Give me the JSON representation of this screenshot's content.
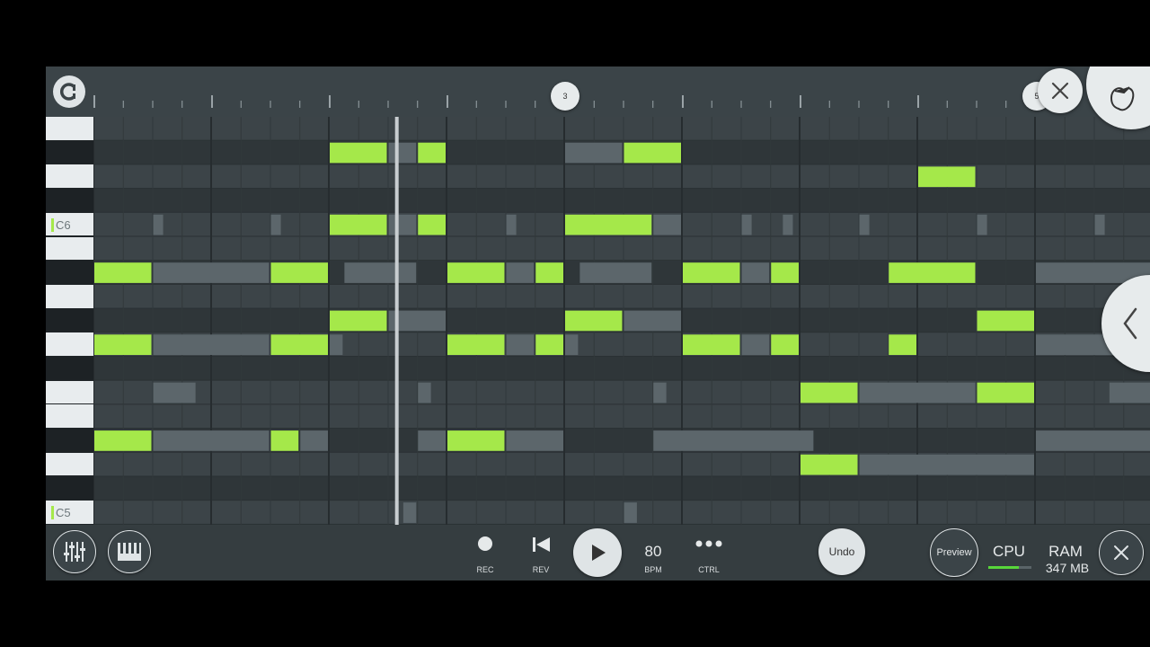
{
  "ruler": {
    "markers": [
      "3",
      "5"
    ]
  },
  "keyboard": {
    "labels": [
      "C6",
      "C5"
    ]
  },
  "toolbar": {
    "rec_label": "REC",
    "rev_label": "REV",
    "tempo_value": "80",
    "tempo_label": "BPM",
    "ctrl_label": "CTRL",
    "undo_label": "Undo",
    "preview_label": "Preview",
    "cpu_label": "CPU",
    "ram_label": "RAM",
    "ram_value": "347 MB"
  },
  "icons": [
    "fl-logo-icon",
    "close-icon",
    "fruit-logo-icon",
    "collapse-chevron-icon",
    "mixer-icon",
    "piano-icon",
    "record-icon",
    "rewind-icon",
    "play-icon",
    "more-icon",
    "close-icon"
  ],
  "colors": {
    "note": "#a5e84a",
    "ghost_note": "#5c666b",
    "grid_bg": "#394045",
    "playhead": "#c8cdd0"
  },
  "notes": [
    {
      "row": 1,
      "start": 8,
      "len": 2
    },
    {
      "row": 1,
      "start": 11,
      "len": 1
    },
    {
      "row": 1,
      "start": 18,
      "len": 2
    },
    {
      "row": 2,
      "start": 28,
      "len": 2
    },
    {
      "row": 4,
      "start": 8,
      "len": 2
    },
    {
      "row": 4,
      "start": 11,
      "len": 1
    },
    {
      "row": 4,
      "start": 16,
      "len": 3
    },
    {
      "row": 6,
      "start": 0,
      "len": 2
    },
    {
      "row": 6,
      "start": 6,
      "len": 2
    },
    {
      "row": 6,
      "start": 12,
      "len": 2
    },
    {
      "row": 6,
      "start": 15,
      "len": 1
    },
    {
      "row": 6,
      "start": 20,
      "len": 2
    },
    {
      "row": 6,
      "start": 23,
      "len": 1
    },
    {
      "row": 6,
      "start": 27,
      "len": 3
    },
    {
      "row": 8,
      "start": 8,
      "len": 2
    },
    {
      "row": 8,
      "start": 16,
      "len": 2
    },
    {
      "row": 8,
      "start": 30,
      "len": 2
    },
    {
      "row": 9,
      "start": 0,
      "len": 2
    },
    {
      "row": 9,
      "start": 6,
      "len": 2
    },
    {
      "row": 9,
      "start": 12,
      "len": 2
    },
    {
      "row": 9,
      "start": 15,
      "len": 1
    },
    {
      "row": 9,
      "start": 20,
      "len": 2
    },
    {
      "row": 9,
      "start": 23,
      "len": 1
    },
    {
      "row": 9,
      "start": 27,
      "len": 1
    },
    {
      "row": 11,
      "start": 24,
      "len": 2
    },
    {
      "row": 11,
      "start": 30,
      "len": 2
    },
    {
      "row": 13,
      "start": 0,
      "len": 2
    },
    {
      "row": 13,
      "start": 6,
      "len": 1
    },
    {
      "row": 13,
      "start": 12,
      "len": 2
    },
    {
      "row": 14,
      "start": 24,
      "len": 2
    }
  ],
  "ghost_notes": [
    {
      "row": 1,
      "start": 10,
      "len": 1
    },
    {
      "row": 1,
      "start": 16,
      "len": 2
    },
    {
      "row": 4,
      "start": 2,
      "len": 0.4
    },
    {
      "row": 4,
      "start": 6,
      "len": 0.4
    },
    {
      "row": 4,
      "start": 10,
      "len": 1
    },
    {
      "row": 4,
      "start": 14,
      "len": 0.4
    },
    {
      "row": 4,
      "start": 19,
      "len": 1
    },
    {
      "row": 4,
      "start": 22,
      "len": 0.4
    },
    {
      "row": 4,
      "start": 23.4,
      "len": 0.4
    },
    {
      "row": 4,
      "start": 26,
      "len": 0.4
    },
    {
      "row": 4,
      "start": 30,
      "len": 0.4
    },
    {
      "row": 4,
      "start": 34,
      "len": 0.4
    },
    {
      "row": 6,
      "start": 2,
      "len": 4
    },
    {
      "row": 6,
      "start": 8.5,
      "len": 2.5
    },
    {
      "row": 6,
      "start": 14,
      "len": 1
    },
    {
      "row": 6,
      "start": 16.5,
      "len": 2.5
    },
    {
      "row": 6,
      "start": 22,
      "len": 1
    },
    {
      "row": 6,
      "start": 32,
      "len": 4
    },
    {
      "row": 8,
      "start": 10,
      "len": 2
    },
    {
      "row": 8,
      "start": 18,
      "len": 2
    },
    {
      "row": 9,
      "start": 2,
      "len": 4
    },
    {
      "row": 9,
      "start": 8,
      "len": 0.5
    },
    {
      "row": 9,
      "start": 14,
      "len": 1
    },
    {
      "row": 9,
      "start": 16,
      "len": 0.5
    },
    {
      "row": 9,
      "start": 22,
      "len": 1
    },
    {
      "row": 9,
      "start": 32,
      "len": 3
    },
    {
      "row": 11,
      "start": 2,
      "len": 1.5
    },
    {
      "row": 11,
      "start": 11,
      "len": 0.5
    },
    {
      "row": 11,
      "start": 19,
      "len": 0.5
    },
    {
      "row": 11,
      "start": 26,
      "len": 4
    },
    {
      "row": 11,
      "start": 34.5,
      "len": 1.5
    },
    {
      "row": 13,
      "start": 2,
      "len": 4
    },
    {
      "row": 13,
      "start": 7,
      "len": 1
    },
    {
      "row": 13,
      "start": 11,
      "len": 1
    },
    {
      "row": 13,
      "start": 14,
      "len": 2
    },
    {
      "row": 13,
      "start": 19,
      "len": 5.5
    },
    {
      "row": 13,
      "start": 32,
      "len": 4
    },
    {
      "row": 14,
      "start": 26,
      "len": 6
    },
    {
      "row": 16,
      "start": 10.5,
      "len": 0.5
    },
    {
      "row": 16,
      "start": 18,
      "len": 0.5
    }
  ]
}
